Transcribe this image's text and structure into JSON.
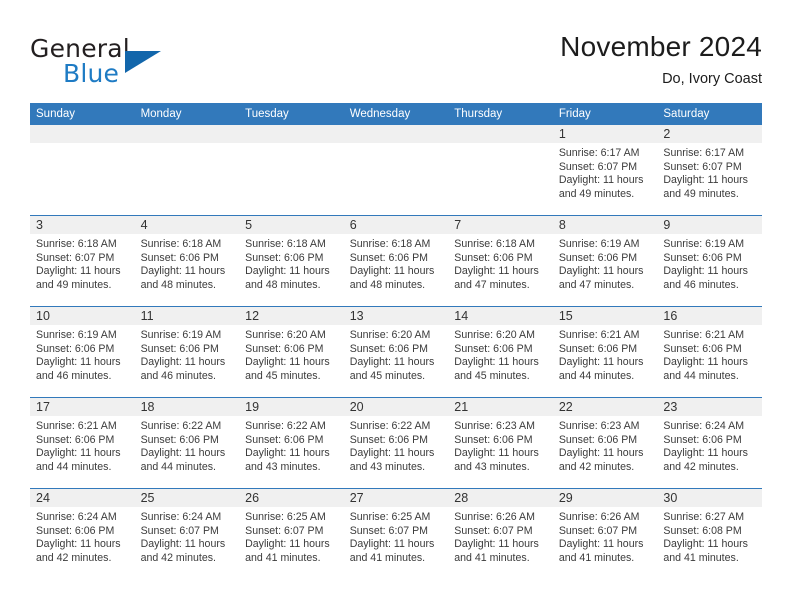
{
  "brand": {
    "word_one": "General",
    "word_two": "Blue",
    "logo_icon": "triangle-logo-icon",
    "color_primary": "#1266ab",
    "color_text": "#231f20",
    "color_blue_text": "#1e7bc4"
  },
  "header": {
    "month_title": "November 2024",
    "location": "Do, Ivory Coast"
  },
  "calendar": {
    "accent_color": "#3279bb",
    "daynum_band_color": "#f0f0f0",
    "weekday_headers": [
      "Sunday",
      "Monday",
      "Tuesday",
      "Wednesday",
      "Thursday",
      "Friday",
      "Saturday"
    ],
    "weeks": [
      [
        {
          "day": "",
          "sunrise": "",
          "sunset": "",
          "daylight_line1": "",
          "daylight_line2": "",
          "empty": true
        },
        {
          "day": "",
          "sunrise": "",
          "sunset": "",
          "daylight_line1": "",
          "daylight_line2": "",
          "empty": true
        },
        {
          "day": "",
          "sunrise": "",
          "sunset": "",
          "daylight_line1": "",
          "daylight_line2": "",
          "empty": true
        },
        {
          "day": "",
          "sunrise": "",
          "sunset": "",
          "daylight_line1": "",
          "daylight_line2": "",
          "empty": true
        },
        {
          "day": "",
          "sunrise": "",
          "sunset": "",
          "daylight_line1": "",
          "daylight_line2": "",
          "empty": true
        },
        {
          "day": "1",
          "sunrise": "Sunrise: 6:17 AM",
          "sunset": "Sunset: 6:07 PM",
          "daylight_line1": "Daylight: 11 hours",
          "daylight_line2": "and 49 minutes.",
          "empty": false
        },
        {
          "day": "2",
          "sunrise": "Sunrise: 6:17 AM",
          "sunset": "Sunset: 6:07 PM",
          "daylight_line1": "Daylight: 11 hours",
          "daylight_line2": "and 49 minutes.",
          "empty": false
        }
      ],
      [
        {
          "day": "3",
          "sunrise": "Sunrise: 6:18 AM",
          "sunset": "Sunset: 6:07 PM",
          "daylight_line1": "Daylight: 11 hours",
          "daylight_line2": "and 49 minutes.",
          "empty": false
        },
        {
          "day": "4",
          "sunrise": "Sunrise: 6:18 AM",
          "sunset": "Sunset: 6:06 PM",
          "daylight_line1": "Daylight: 11 hours",
          "daylight_line2": "and 48 minutes.",
          "empty": false
        },
        {
          "day": "5",
          "sunrise": "Sunrise: 6:18 AM",
          "sunset": "Sunset: 6:06 PM",
          "daylight_line1": "Daylight: 11 hours",
          "daylight_line2": "and 48 minutes.",
          "empty": false
        },
        {
          "day": "6",
          "sunrise": "Sunrise: 6:18 AM",
          "sunset": "Sunset: 6:06 PM",
          "daylight_line1": "Daylight: 11 hours",
          "daylight_line2": "and 48 minutes.",
          "empty": false
        },
        {
          "day": "7",
          "sunrise": "Sunrise: 6:18 AM",
          "sunset": "Sunset: 6:06 PM",
          "daylight_line1": "Daylight: 11 hours",
          "daylight_line2": "and 47 minutes.",
          "empty": false
        },
        {
          "day": "8",
          "sunrise": "Sunrise: 6:19 AM",
          "sunset": "Sunset: 6:06 PM",
          "daylight_line1": "Daylight: 11 hours",
          "daylight_line2": "and 47 minutes.",
          "empty": false
        },
        {
          "day": "9",
          "sunrise": "Sunrise: 6:19 AM",
          "sunset": "Sunset: 6:06 PM",
          "daylight_line1": "Daylight: 11 hours",
          "daylight_line2": "and 46 minutes.",
          "empty": false
        }
      ],
      [
        {
          "day": "10",
          "sunrise": "Sunrise: 6:19 AM",
          "sunset": "Sunset: 6:06 PM",
          "daylight_line1": "Daylight: 11 hours",
          "daylight_line2": "and 46 minutes.",
          "empty": false
        },
        {
          "day": "11",
          "sunrise": "Sunrise: 6:19 AM",
          "sunset": "Sunset: 6:06 PM",
          "daylight_line1": "Daylight: 11 hours",
          "daylight_line2": "and 46 minutes.",
          "empty": false
        },
        {
          "day": "12",
          "sunrise": "Sunrise: 6:20 AM",
          "sunset": "Sunset: 6:06 PM",
          "daylight_line1": "Daylight: 11 hours",
          "daylight_line2": "and 45 minutes.",
          "empty": false
        },
        {
          "day": "13",
          "sunrise": "Sunrise: 6:20 AM",
          "sunset": "Sunset: 6:06 PM",
          "daylight_line1": "Daylight: 11 hours",
          "daylight_line2": "and 45 minutes.",
          "empty": false
        },
        {
          "day": "14",
          "sunrise": "Sunrise: 6:20 AM",
          "sunset": "Sunset: 6:06 PM",
          "daylight_line1": "Daylight: 11 hours",
          "daylight_line2": "and 45 minutes.",
          "empty": false
        },
        {
          "day": "15",
          "sunrise": "Sunrise: 6:21 AM",
          "sunset": "Sunset: 6:06 PM",
          "daylight_line1": "Daylight: 11 hours",
          "daylight_line2": "and 44 minutes.",
          "empty": false
        },
        {
          "day": "16",
          "sunrise": "Sunrise: 6:21 AM",
          "sunset": "Sunset: 6:06 PM",
          "daylight_line1": "Daylight: 11 hours",
          "daylight_line2": "and 44 minutes.",
          "empty": false
        }
      ],
      [
        {
          "day": "17",
          "sunrise": "Sunrise: 6:21 AM",
          "sunset": "Sunset: 6:06 PM",
          "daylight_line1": "Daylight: 11 hours",
          "daylight_line2": "and 44 minutes.",
          "empty": false
        },
        {
          "day": "18",
          "sunrise": "Sunrise: 6:22 AM",
          "sunset": "Sunset: 6:06 PM",
          "daylight_line1": "Daylight: 11 hours",
          "daylight_line2": "and 44 minutes.",
          "empty": false
        },
        {
          "day": "19",
          "sunrise": "Sunrise: 6:22 AM",
          "sunset": "Sunset: 6:06 PM",
          "daylight_line1": "Daylight: 11 hours",
          "daylight_line2": "and 43 minutes.",
          "empty": false
        },
        {
          "day": "20",
          "sunrise": "Sunrise: 6:22 AM",
          "sunset": "Sunset: 6:06 PM",
          "daylight_line1": "Daylight: 11 hours",
          "daylight_line2": "and 43 minutes.",
          "empty": false
        },
        {
          "day": "21",
          "sunrise": "Sunrise: 6:23 AM",
          "sunset": "Sunset: 6:06 PM",
          "daylight_line1": "Daylight: 11 hours",
          "daylight_line2": "and 43 minutes.",
          "empty": false
        },
        {
          "day": "22",
          "sunrise": "Sunrise: 6:23 AM",
          "sunset": "Sunset: 6:06 PM",
          "daylight_line1": "Daylight: 11 hours",
          "daylight_line2": "and 42 minutes.",
          "empty": false
        },
        {
          "day": "23",
          "sunrise": "Sunrise: 6:24 AM",
          "sunset": "Sunset: 6:06 PM",
          "daylight_line1": "Daylight: 11 hours",
          "daylight_line2": "and 42 minutes.",
          "empty": false
        }
      ],
      [
        {
          "day": "24",
          "sunrise": "Sunrise: 6:24 AM",
          "sunset": "Sunset: 6:06 PM",
          "daylight_line1": "Daylight: 11 hours",
          "daylight_line2": "and 42 minutes.",
          "empty": false
        },
        {
          "day": "25",
          "sunrise": "Sunrise: 6:24 AM",
          "sunset": "Sunset: 6:07 PM",
          "daylight_line1": "Daylight: 11 hours",
          "daylight_line2": "and 42 minutes.",
          "empty": false
        },
        {
          "day": "26",
          "sunrise": "Sunrise: 6:25 AM",
          "sunset": "Sunset: 6:07 PM",
          "daylight_line1": "Daylight: 11 hours",
          "daylight_line2": "and 41 minutes.",
          "empty": false
        },
        {
          "day": "27",
          "sunrise": "Sunrise: 6:25 AM",
          "sunset": "Sunset: 6:07 PM",
          "daylight_line1": "Daylight: 11 hours",
          "daylight_line2": "and 41 minutes.",
          "empty": false
        },
        {
          "day": "28",
          "sunrise": "Sunrise: 6:26 AM",
          "sunset": "Sunset: 6:07 PM",
          "daylight_line1": "Daylight: 11 hours",
          "daylight_line2": "and 41 minutes.",
          "empty": false
        },
        {
          "day": "29",
          "sunrise": "Sunrise: 6:26 AM",
          "sunset": "Sunset: 6:07 PM",
          "daylight_line1": "Daylight: 11 hours",
          "daylight_line2": "and 41 minutes.",
          "empty": false
        },
        {
          "day": "30",
          "sunrise": "Sunrise: 6:27 AM",
          "sunset": "Sunset: 6:08 PM",
          "daylight_line1": "Daylight: 11 hours",
          "daylight_line2": "and 41 minutes.",
          "empty": false
        }
      ]
    ]
  }
}
